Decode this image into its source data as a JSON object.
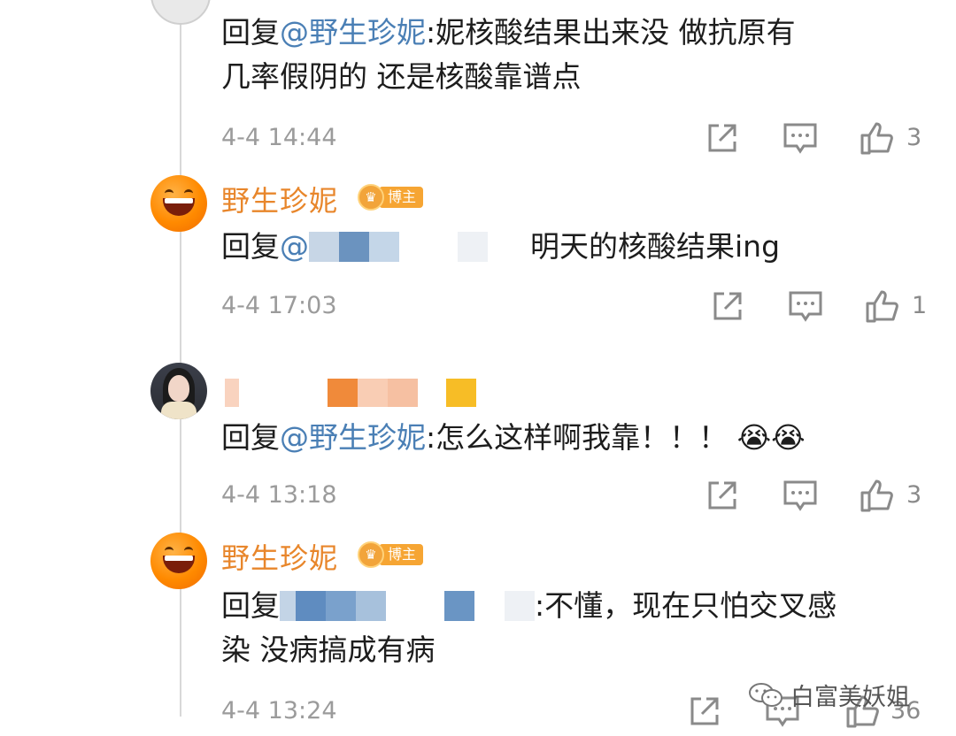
{
  "comments": [
    {
      "reply_prefix": "回复",
      "mention": "@野生珍妮",
      "text_line1": ":妮核酸结果出来没 做抗原有",
      "text_line2": "几率假阴的 还是核酸靠谱点",
      "time": "4-4 14:44",
      "likes": "3"
    },
    {
      "username": "野生珍妮",
      "badge": "博主",
      "reply_prefix": "回复",
      "mention_partial": "@",
      "text": "明天的核酸结果ing",
      "time": "4-4 17:03",
      "likes": "1"
    },
    {
      "reply_prefix": "回复",
      "mention": "@野生珍妮",
      "text": ":怎么这样啊我靠！！！",
      "emoji": "😭😭",
      "time": "4-4 13:18",
      "likes": "3"
    },
    {
      "username": "野生珍妮",
      "badge": "博主",
      "reply_prefix": "回复",
      "text_line1": ":不懂，现在只怕交叉感",
      "text_line2": "染 没病搞成有病",
      "time": "4-4 13:24",
      "likes": "36"
    }
  ],
  "watermark": {
    "label": "白富美妖姐"
  },
  "icons": {
    "share": "share-icon",
    "comment": "comment-icon",
    "like": "thumbs-up-icon"
  },
  "colors": {
    "username": "#e8862b",
    "mention": "#4a7fb5",
    "meta": "#9b9b9b",
    "badge": "#f6a533"
  }
}
